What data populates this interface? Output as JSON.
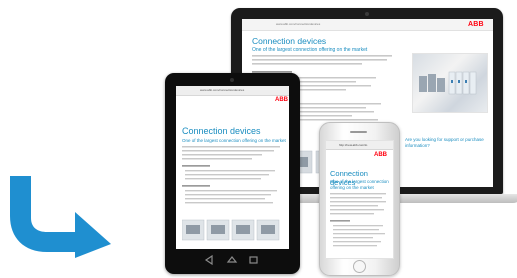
{
  "colors": {
    "accent_blue": "#1a8dc0",
    "arrow_blue": "#1f8fd0",
    "brand_red": "#ff000f",
    "device_black": "#111111"
  },
  "arrow": {
    "icon": "curved-arrow-right-icon"
  },
  "laptop": {
    "url": "www.abb.com/connectiondevices",
    "logo": "ABB",
    "page_title": "Connection devices",
    "subtitle": "One of the largest connection offering on the market",
    "side_link_1": "Are you looking for support or purchase",
    "side_link_2": "information?"
  },
  "tablet": {
    "url": "www.abb.com/connectiondevices",
    "logo": "ABB",
    "page_title": "Connection devices",
    "subtitle": "One of the largest connection offering on the market"
  },
  "phone": {
    "url": "http://new.abb.com/lo",
    "logo": "ABB",
    "page_title": "Connection devices",
    "subtitle_line_1": "One of the largest connection",
    "subtitle_line_2": "offering on the market"
  }
}
